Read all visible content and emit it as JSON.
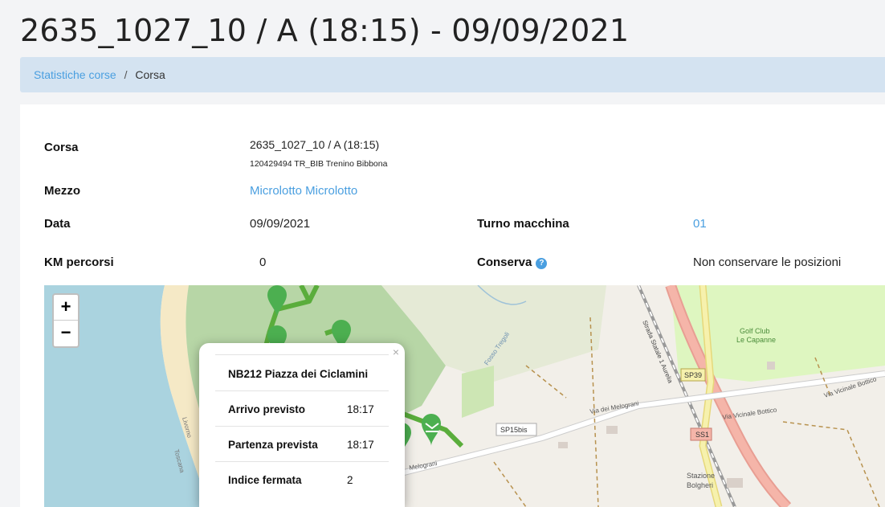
{
  "page": {
    "title": "2635_1027_10 / A (18:15) - 09/09/2021"
  },
  "breadcrumb": {
    "parent": "Statistiche corse",
    "separator": "/",
    "current": "Corsa"
  },
  "details": {
    "corsa_label": "Corsa",
    "corsa_value": "2635_1027_10 / A (18:15)",
    "corsa_sub": "120429494 TR_BIB Trenino Bibbona",
    "mezzo_label": "Mezzo",
    "mezzo_value": "Microlotto Microlotto",
    "data_label": "Data",
    "data_value": "09/09/2021",
    "turno_label": "Turno macchina",
    "turno_value": "01",
    "km_label": "KM percorsi",
    "km_value": "0",
    "conserva_label": "Conserva",
    "conserva_help": "?",
    "conserva_value": "Non conservare le posizioni"
  },
  "map": {
    "zoom_in": "+",
    "zoom_out": "−",
    "labels": {
      "fosso": "Fosso Tregoli",
      "aurelia": "Strada Statale 1 Aurelia",
      "melograni": "Via dei Melograni",
      "melograni2": "Melograni",
      "vicinale1": "Via Vicinale Bottico",
      "vicinale2": "Via Vicinale Bottico",
      "sp15": "SP15bis",
      "sp39": "SP39",
      "ss1": "SS1",
      "golf": "Golf Club",
      "golf2": "Le Capanne",
      "stazione": "Stazione",
      "stazione2": "Bolgheri",
      "livorno": "Livorno",
      "toscana": "Toscana"
    },
    "colors": {
      "route": "#5aad3c",
      "marker": "#4caf50"
    }
  },
  "popup": {
    "close": "×",
    "stop_name": "NB212 Piazza dei Ciclamini",
    "rows": [
      {
        "key": "Arrivo previsto",
        "value": "18:17"
      },
      {
        "key": "Partenza prevista",
        "value": "18:17"
      },
      {
        "key": "Indice fermata",
        "value": "2"
      }
    ]
  }
}
